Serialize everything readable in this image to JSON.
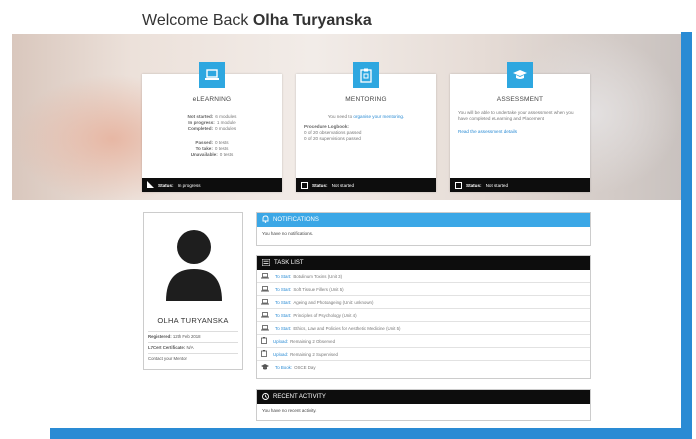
{
  "header": {
    "welcome_prefix": "Welcome Back",
    "user_name": "Olha Turyanska"
  },
  "cards": {
    "elearning": {
      "title": "eLEARNING",
      "stats": [
        {
          "label": "Not started:",
          "value": "6 modules"
        },
        {
          "label": "In progress:",
          "value": "1 module"
        },
        {
          "label": "Completed:",
          "value": "0 modules"
        }
      ],
      "tests": [
        {
          "label": "Passed:",
          "value": "0 tests"
        },
        {
          "label": "To take:",
          "value": "0 tests"
        },
        {
          "label": "Unavailable:",
          "value": "0 tests"
        }
      ],
      "status_label": "Status:",
      "status_value": "In progress"
    },
    "mentoring": {
      "title": "MENTORING",
      "intro": "You need to",
      "intro_link": "organise your mentoring.",
      "logbook_title": "Procedure Logbook:",
      "logbook_line1": "0 of 20 observations passed",
      "logbook_line2": "0 of 20 supervisions passed",
      "status_label": "Status:",
      "status_value": "Not started"
    },
    "assessment": {
      "title": "ASSESSMENT",
      "text": "You will be able to undertake your assessment when you have completed eLearning and Placement",
      "link": "Read the assessment details",
      "status_label": "Status:",
      "status_value": "Not started"
    }
  },
  "profile": {
    "name": "OLHA TURYANSKA",
    "registered_label": "Registered:",
    "registered_value": "12th Feb 2018",
    "cert_label": "L7Cert Certificate:",
    "cert_value": "N/A",
    "mentor_link": "Contact your Mentor"
  },
  "notifications": {
    "title": "NOTIFICATIONS",
    "empty": "You have no notifications."
  },
  "task_list": {
    "title": "TASK LIST",
    "items": [
      {
        "icon": "laptop-icon",
        "action": "To Start:",
        "text": "Botulinum Toxins (Unit 3)"
      },
      {
        "icon": "laptop-icon",
        "action": "To Start:",
        "text": "Soft Tissue Fillers (Unit 5)"
      },
      {
        "icon": "laptop-icon",
        "action": "To Start:",
        "text": "Ageing and Photoageing (Unit: unknown)"
      },
      {
        "icon": "laptop-icon",
        "action": "To Start:",
        "text": "Principles of Psychology (Unit 4)"
      },
      {
        "icon": "laptop-icon",
        "action": "To Start:",
        "text": "Ethics, Law and Policies for Aesthetic Medicine (Unit 5)"
      },
      {
        "icon": "clipboard-icon",
        "action": "Upload:",
        "text": "Remaining 2 Observed"
      },
      {
        "icon": "clipboard-icon",
        "action": "Upload:",
        "text": "Remaining 2 Supervised"
      },
      {
        "icon": "graduation-cap-icon",
        "action": "To Book:",
        "text": "OSCE Day"
      }
    ]
  },
  "recent_activity": {
    "title": "RECENT ACTIVITY",
    "empty": "You have no recent activity."
  },
  "colors": {
    "accent": "#2ea7e0",
    "frame": "#2a8bd4",
    "notif_header": "#3ba7e6",
    "dark": "#0d0d0d"
  }
}
